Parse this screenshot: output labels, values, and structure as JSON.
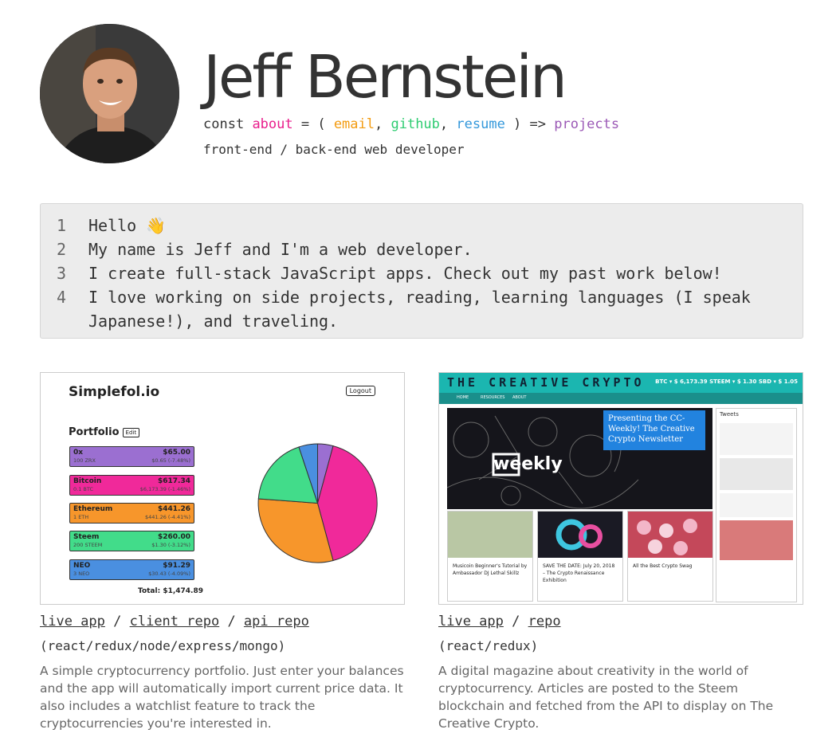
{
  "profile": {
    "name": "Jeff Bernstein",
    "code": {
      "const": "const",
      "about": "about",
      "eq": " = ( ",
      "email": "email",
      "c1": ", ",
      "github": "github",
      "c2": ", ",
      "resume": "resume",
      "arrow": " ) => ",
      "projects": "projects"
    },
    "subtitle": "front-end / back-end web developer"
  },
  "colors": {
    "about": "#e91e8c",
    "email": "#f39c12",
    "github": "#2ecc71",
    "resume": "#3498db",
    "projects": "#9b59b6"
  },
  "intro": [
    {
      "num": "1",
      "text": "Hello 👋"
    },
    {
      "num": "2",
      "text": "My name is Jeff and I'm a web developer."
    },
    {
      "num": "3",
      "text": "I create full-stack JavaScript apps. Check out my past work below!"
    },
    {
      "num": "4",
      "text": "I love working on side projects, reading, learning languages (I speak Japanese!), and traveling."
    }
  ],
  "projects": [
    {
      "links": [
        "live app",
        "client repo",
        "api repo"
      ],
      "sep": " / ",
      "stack": "(react/redux/node/express/mongo)",
      "description": "A simple cryptocurrency portfolio. Just enter your balances and the app will automatically import current price data. It also includes a watchlist feature to track the cryptocurrencies you're interested in.",
      "screenshot": {
        "brand": "Simplefol.io",
        "logout": "Logout",
        "portfolio": "Portfolio",
        "edit": "Edit",
        "coins": [
          {
            "name": "0x",
            "value": "$65.00",
            "amount": "100 ZRX",
            "change": "$0.65 (-7.48%)",
            "color": "#9b6fd1"
          },
          {
            "name": "Bitcoin",
            "value": "$617.34",
            "amount": "0.1 BTC",
            "change": "$6,173.39 (-1.46%)",
            "color": "#f0299a"
          },
          {
            "name": "Ethereum",
            "value": "$441.26",
            "amount": "1 ETH",
            "change": "$441.26 (-4.41%)",
            "color": "#f7962b"
          },
          {
            "name": "Steem",
            "value": "$260.00",
            "amount": "200 STEEM",
            "change": "$1.30 (-3.12%)",
            "color": "#42dc8a"
          },
          {
            "name": "NEO",
            "value": "$91.29",
            "amount": "3 NEO",
            "change": "$30.43 (-4.09%)",
            "color": "#4a8fe0"
          }
        ],
        "total": "Total: $1,474.89"
      }
    },
    {
      "links": [
        "live app",
        "repo"
      ],
      "sep": " / ",
      "stack": "(react/redux)",
      "description": "A digital magazine about creativity in the world of cryptocurrency. Articles are posted to the Steem blockchain and fetched from the API to display on The Creative Crypto.",
      "screenshot": {
        "logo": "THE CREATIVE CRYPTO",
        "prices": "BTC ▾ $ 6,173.39    STEEM ▾ $ 1.30    SBD ▾ $ 1.05",
        "nav": [
          "HOME",
          "RESOURCES",
          "ABOUT"
        ],
        "weekly": "weekly",
        "feature_title": "Presenting the CC-Weekly! The Creative Crypto Newsletter",
        "tweets_title": "Tweets",
        "cards": [
          "Musicoin Beginner's Tutorial by Ambassador DJ Lethal Skillz",
          "SAVE THE DATE: July 20, 2018 – The Crypto Renaissance Exhibition",
          "All the Best Crypto Swag"
        ]
      }
    }
  ]
}
